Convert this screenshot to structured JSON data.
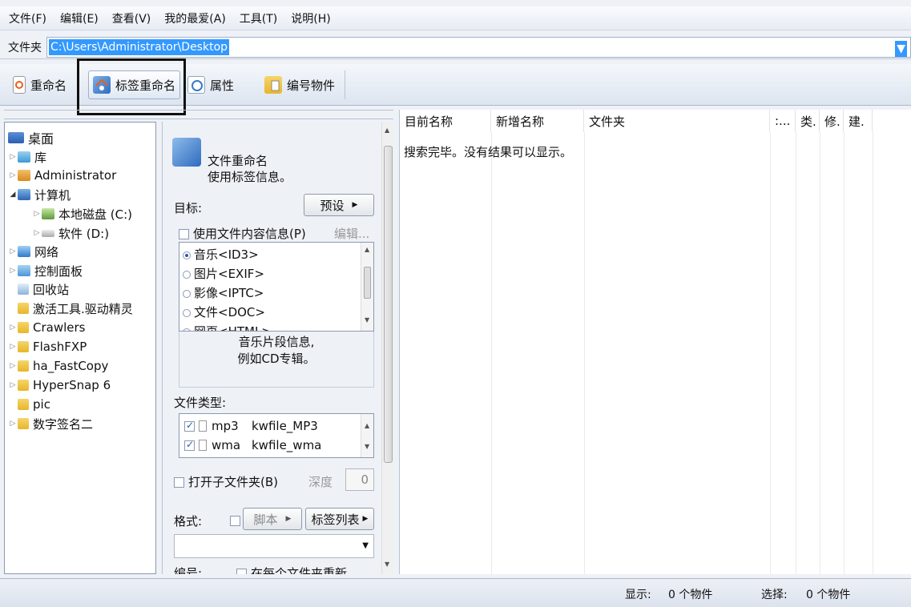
{
  "menu": [
    "文件(F)",
    "编辑(E)",
    "查看(V)",
    "我的最爱(A)",
    "工具(T)",
    "说明(H)"
  ],
  "address": {
    "label": "文件夹",
    "path": "C:\\Users\\Administrator\\Desktop"
  },
  "toolbar": {
    "rename": "重命名",
    "tag_rename": "标签重命名",
    "properties": "属性",
    "number_items": "编号物件"
  },
  "tree": [
    {
      "label": "桌面",
      "icon": "desktop-icon"
    },
    {
      "label": "库",
      "icon": "library-icon"
    },
    {
      "label": "Administrator",
      "icon": "user-icon"
    },
    {
      "label": "计算机",
      "icon": "computer-icon"
    },
    {
      "label": "本地磁盘 (C:)",
      "icon": "drive-icon"
    },
    {
      "label": "软件 (D:)",
      "icon": "drive-icon"
    },
    {
      "label": "网络",
      "icon": "network-icon"
    },
    {
      "label": "控制面板",
      "icon": "control-panel-icon"
    },
    {
      "label": "回收站",
      "icon": "recycle-bin-icon"
    },
    {
      "label": "激活工具.驱动精灵",
      "icon": "folder-icon"
    },
    {
      "label": "Crawlers",
      "icon": "folder-icon"
    },
    {
      "label": "FlashFXP",
      "icon": "folder-icon"
    },
    {
      "label": "ha_FastCopy",
      "icon": "folder-icon"
    },
    {
      "label": "HyperSnap 6",
      "icon": "folder-icon"
    },
    {
      "label": "pic",
      "icon": "folder-icon"
    },
    {
      "label": "数字签名二",
      "icon": "folder-icon"
    }
  ],
  "panel": {
    "title": "文件重命名",
    "subtitle": "使用标签信息。",
    "target_label": "目标:",
    "preset_btn": "预设",
    "use_content": "使用文件内容信息(P)",
    "edit": "编辑...",
    "sources": [
      "音乐<ID3>",
      "图片<EXIF>",
      "影像<IPTC>",
      "文件<DOC>",
      "网页<HTML>"
    ],
    "desc_line1": "音乐片段信息,",
    "desc_line2": "例如CD专辑。",
    "filetype_label": "文件类型:",
    "filetypes": [
      {
        "ext": "mp3",
        "name": "kwfile_MP3"
      },
      {
        "ext": "wma",
        "name": "kwfile_wma"
      }
    ],
    "open_subfolder": "打开子文件夹(B)",
    "depth_label": "深度",
    "depth_value": "0",
    "format_label": "格式:",
    "script_btn": "脚本",
    "tag_list_btn": "标签列表",
    "number_label": "编号:",
    "per_folder": "在每个文件夹重新..."
  },
  "columns": {
    "current": "目前名称",
    "new": "新增名称",
    "folder": "文件夹",
    "c4": ":...",
    "c5": "类.",
    "c6": "修.",
    "c7": "建."
  },
  "result_msg": "搜索完毕。没有结果可以显示。",
  "status": {
    "show_label": "显示:",
    "show_value": "0 个物件",
    "select_label": "选择:",
    "select_value": "0 个物件"
  }
}
